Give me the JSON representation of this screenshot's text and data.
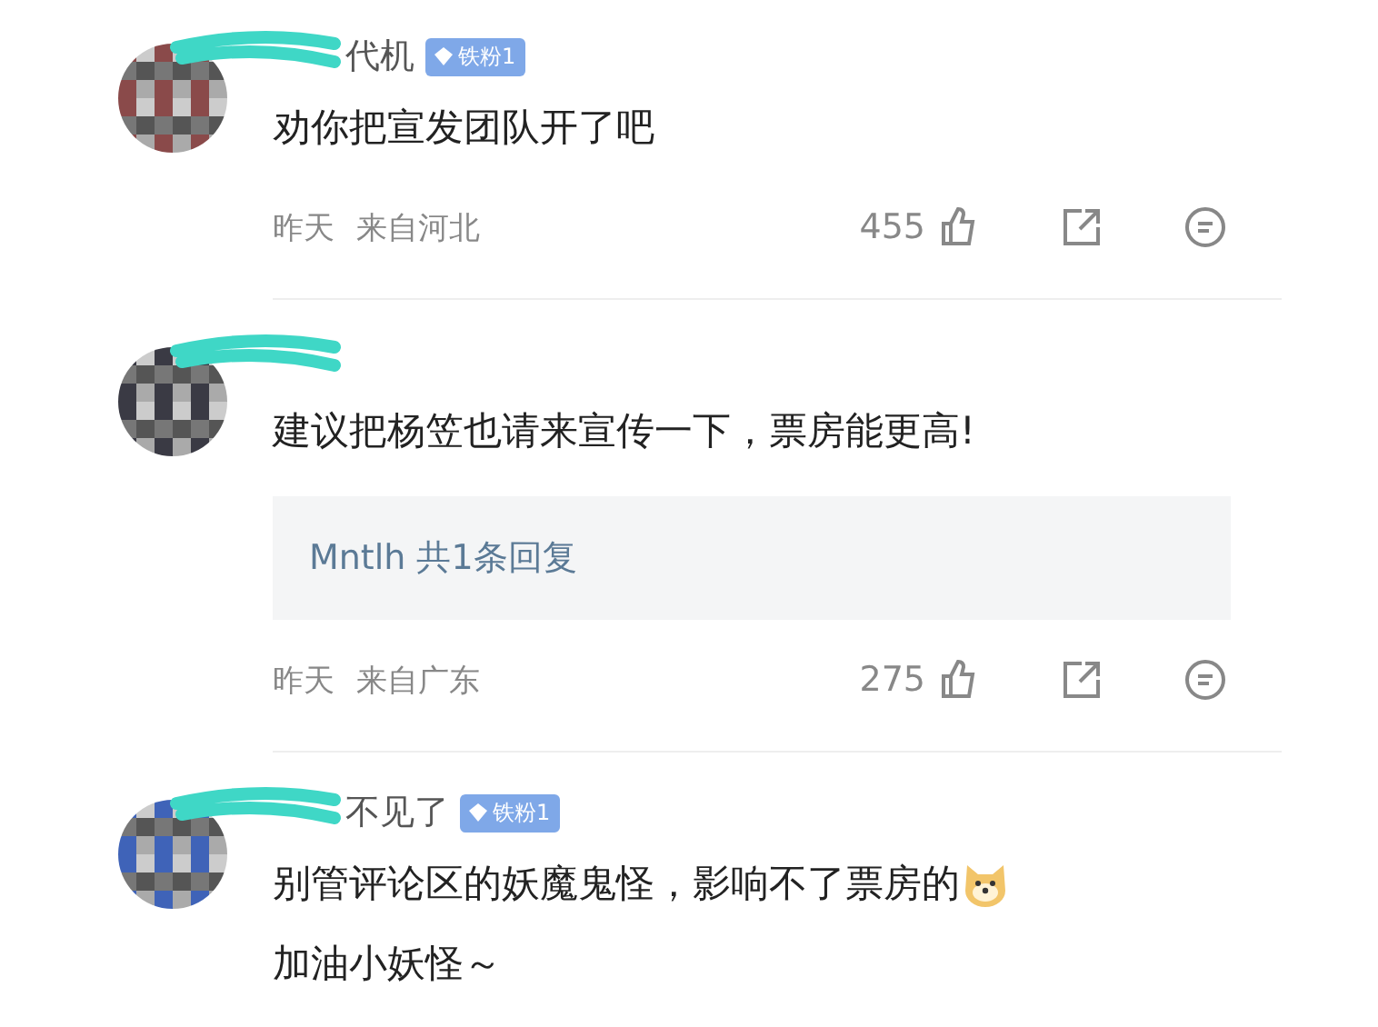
{
  "comments": [
    {
      "avatar": {
        "kind": "picture",
        "color": "#8a4a4a"
      },
      "name": "代机",
      "badge": "铁粉1",
      "lines": [
        "劝你把宣发团队开了吧"
      ],
      "time": "昨天",
      "location": "来自河北",
      "likes": "455"
    },
    {
      "avatar": {
        "kind": "picture",
        "color": "#3a3a44"
      },
      "lines": [
        "建议把杨笠也请来宣传一下，票房能更高!"
      ],
      "reply": {
        "user": "Mntlh",
        "count": "共1条回复"
      },
      "time": "昨天",
      "location": "来自广东",
      "likes": "275"
    },
    {
      "avatar": {
        "kind": "picture",
        "color": "#3f63b8"
      },
      "name": "不见了",
      "badge": "铁粉1",
      "lines": [
        "别管评论区的妖魔鬼怪，影响不了票房的",
        "加油小妖怪～"
      ],
      "emoji": true
    }
  ]
}
